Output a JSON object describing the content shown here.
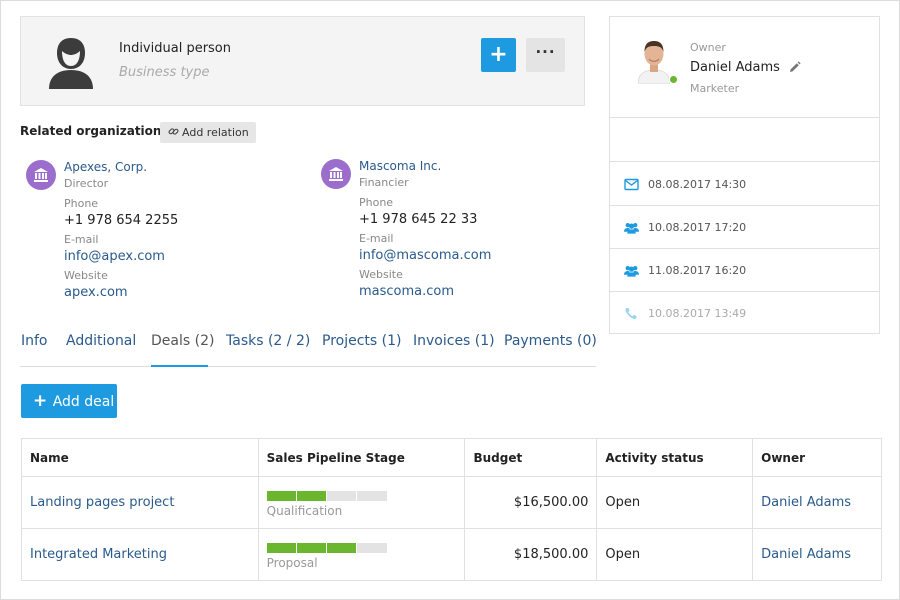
{
  "person": {
    "type": "Individual person",
    "subtitle": "Business type",
    "add_button": "+",
    "more_button": "···"
  },
  "related": {
    "title": "Related organizations",
    "add_relation": "Add relation",
    "orgs": [
      {
        "name": "Apexes, Corp.",
        "role": "Director",
        "phone_label": "Phone",
        "phone": "+1 978 654 2255",
        "email_label": "E-mail",
        "email": "info@apex.com",
        "website_label": "Website",
        "website": "apex.com"
      },
      {
        "name": "Mascoma Inc.",
        "role": "Financier",
        "phone_label": "Phone",
        "phone": "+1 978 645 22 33",
        "email_label": "E-mail",
        "email": "info@mascoma.com",
        "website_label": "Website",
        "website": "mascoma.com"
      }
    ]
  },
  "tabs": [
    {
      "label": "Info",
      "active": false
    },
    {
      "label": "Additional",
      "active": false
    },
    {
      "label": "Deals (2)",
      "active": true
    },
    {
      "label": "Tasks (2 / 2)",
      "active": false
    },
    {
      "label": "Projects (1)",
      "active": false
    },
    {
      "label": "Invoices (1)",
      "active": false
    },
    {
      "label": "Payments (0)",
      "active": false
    }
  ],
  "deals": {
    "add_label": "Add deal",
    "columns": [
      "Name",
      "Sales Pipeline Stage",
      "Budget",
      "Activity status",
      "Owner"
    ],
    "rows": [
      {
        "name": "Landing pages project",
        "stage": "Qualification",
        "stage_filled": 2,
        "stage_total": 4,
        "budget": "$16,500.00",
        "status": "Open",
        "owner": "Daniel Adams"
      },
      {
        "name": "Integrated Marketing",
        "stage": "Proposal",
        "stage_filled": 3,
        "stage_total": 4,
        "budget": "$18,500.00",
        "status": "Open",
        "owner": "Daniel Adams"
      }
    ]
  },
  "owner": {
    "label": "Owner",
    "name": "Daniel Adams",
    "role": "Marketer",
    "online": true
  },
  "activities": [
    {
      "icon": "envelope-icon",
      "text": "08.08.2017 14:30",
      "dim": false
    },
    {
      "icon": "users-icon",
      "text": "10.08.2017 17:20",
      "dim": false
    },
    {
      "icon": "users-icon",
      "text": "11.08.2017 16:20",
      "dim": false
    },
    {
      "icon": "phone-icon",
      "text": "10.08.2017 13:49",
      "dim": true
    }
  ],
  "colors": {
    "primary": "#1e9be0",
    "link": "#2a5a8c",
    "org_icon": "#9b6dcc",
    "pipeline_on": "#6ab62f",
    "pipeline_off": "#e3e3e3",
    "online": "#6ab62f"
  }
}
